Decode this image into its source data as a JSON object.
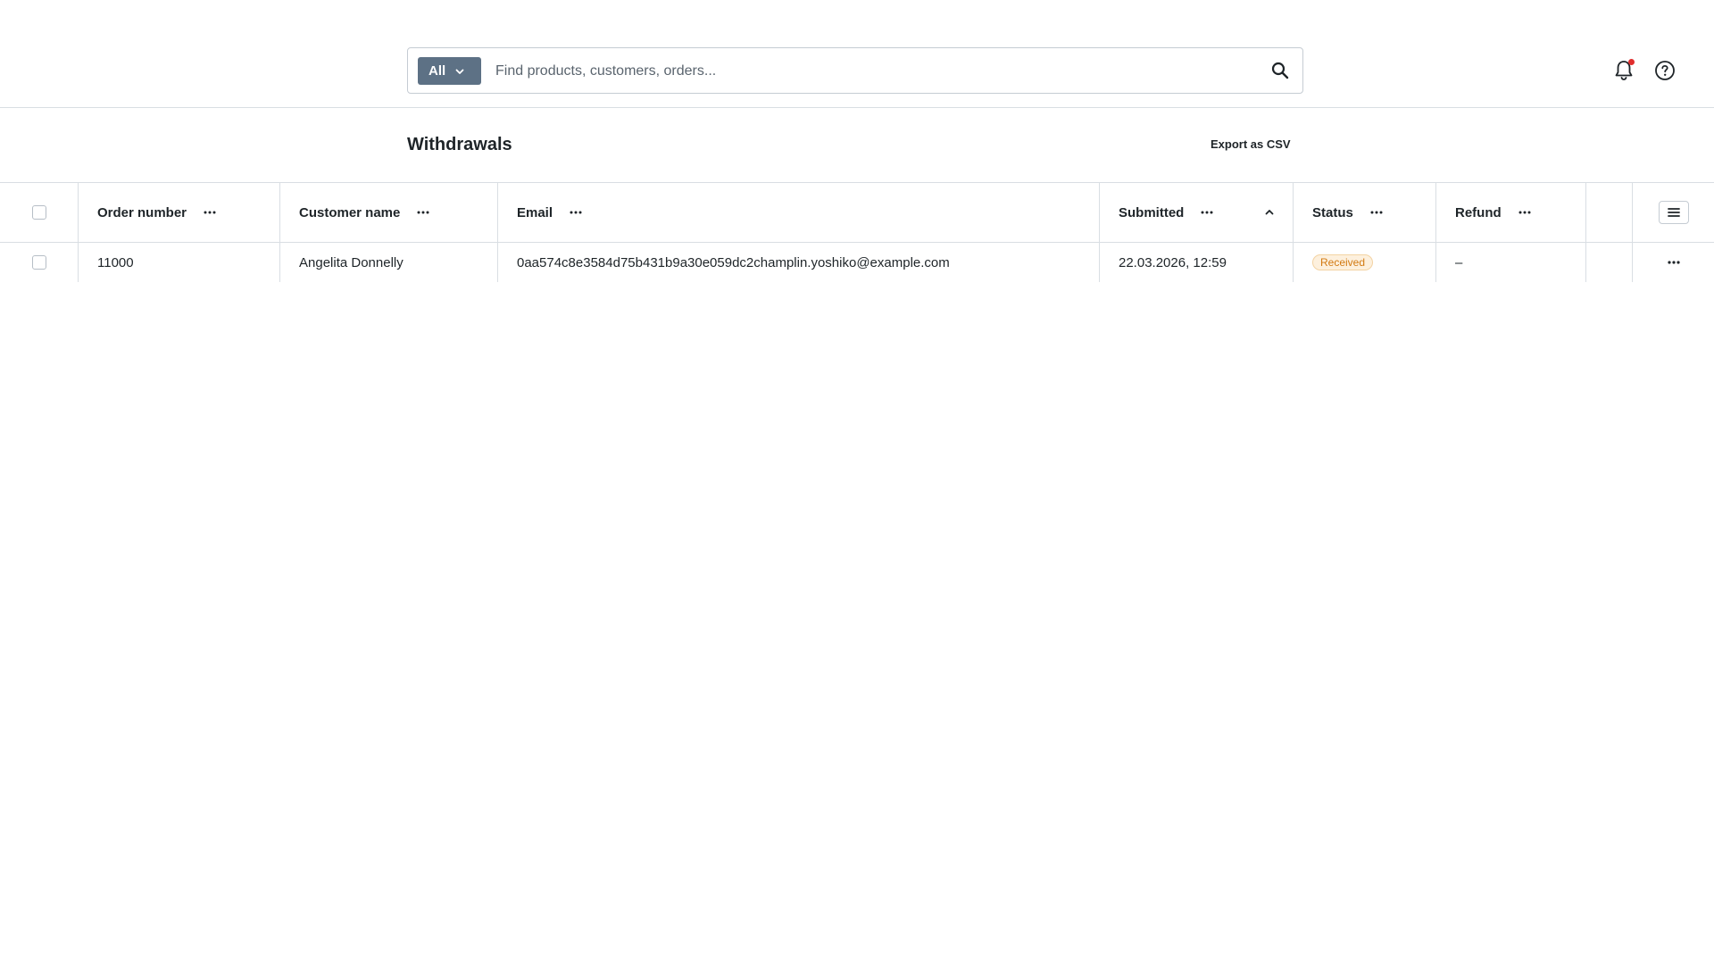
{
  "search": {
    "scope_label": "All",
    "placeholder": "Find products, customers, orders..."
  },
  "page": {
    "title": "Withdrawals",
    "export_label": "Export as CSV"
  },
  "table": {
    "columns": [
      {
        "key": "order_number",
        "label": "Order number"
      },
      {
        "key": "customer_name",
        "label": "Customer name"
      },
      {
        "key": "email",
        "label": "Email"
      },
      {
        "key": "submitted",
        "label": "Submitted",
        "sorted": "ascending"
      },
      {
        "key": "status",
        "label": "Status"
      },
      {
        "key": "refund",
        "label": "Refund"
      }
    ],
    "rows": [
      {
        "order_number": "11000",
        "customer_name": "Angelita Donnelly",
        "email": "0aa574c8e3584d75b431b9a30e059dc2champlin.yoshiko@example.com",
        "submitted": "22.03.2026, 12:59",
        "status": "Received",
        "refund": "–"
      }
    ]
  },
  "colors": {
    "scope_button": "#5d7185",
    "notification_dot": "#e02d2d",
    "status_received": "#d27a12"
  },
  "icons": [
    "chevron-down-icon",
    "search-icon",
    "bell-icon",
    "help-icon",
    "more-horizontal-icon",
    "sort-ascending-icon",
    "column-settings-icon"
  ]
}
